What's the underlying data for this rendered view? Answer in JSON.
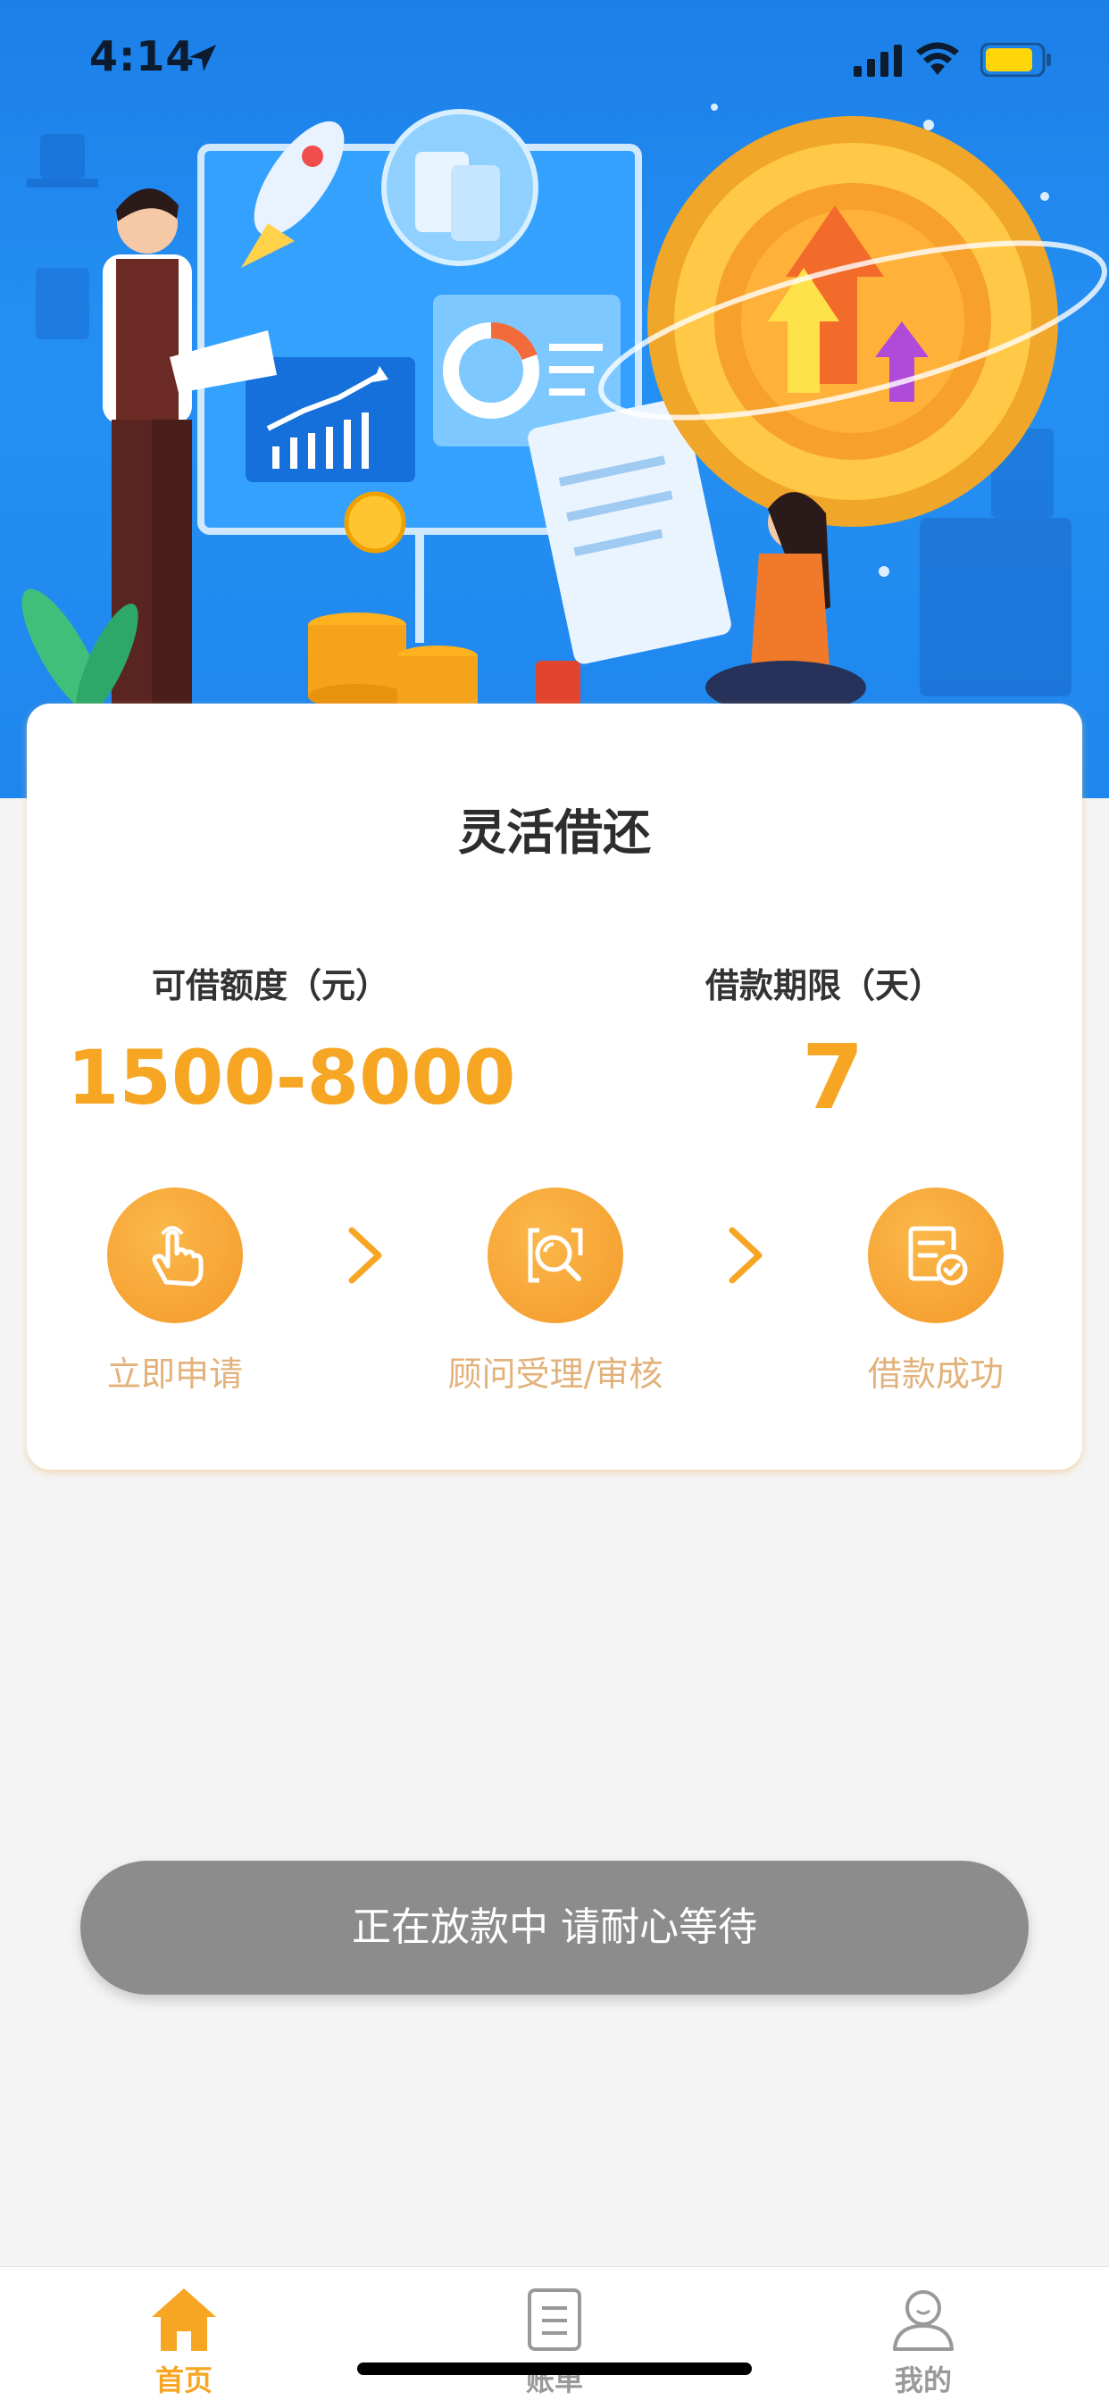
{
  "status_bar": {
    "time": "4:14",
    "icons": [
      "location-arrow-icon",
      "cellular-signal-icon",
      "wifi-icon",
      "battery-icon"
    ]
  },
  "banner": {
    "illustration": "finance-illustration"
  },
  "card": {
    "title": "灵活借还",
    "amount_label": "可借额度（元）",
    "amount_value": "1500-8000",
    "term_label": "借款期限（天）",
    "term_value": "7",
    "steps": [
      {
        "label": "立即申请",
        "icon": "hand-tap-icon"
      },
      {
        "label": "顾问受理/审核",
        "icon": "review-search-icon"
      },
      {
        "label": "借款成功",
        "icon": "document-check-icon"
      }
    ]
  },
  "toast": {
    "message": "正在放款中 请耐心等待"
  },
  "tab_bar": {
    "tabs": [
      {
        "label": "首页",
        "icon": "home-icon",
        "active": true
      },
      {
        "label": "账单",
        "icon": "bill-icon",
        "active": false
      },
      {
        "label": "我的",
        "icon": "profile-icon",
        "active": false
      }
    ]
  },
  "colors": {
    "accent": "#f6a623",
    "banner_blue": "#1f88ef",
    "toast_bg": "#8c8c8c",
    "step_label": "#e2b27b",
    "page_bg": "#f4f4f4"
  }
}
